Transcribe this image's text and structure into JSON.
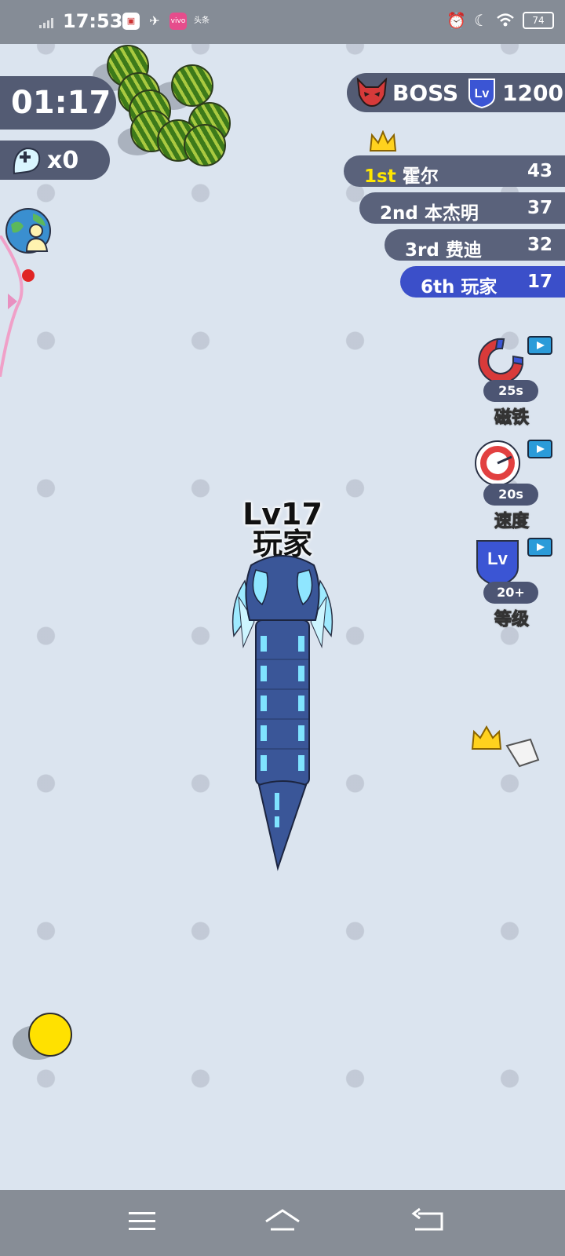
{
  "status_bar": {
    "time": "17:53",
    "battery": "74",
    "app_icons": [
      "notification-app-icon",
      "bird-icon",
      "vivo-icon",
      "toutiao-icon"
    ],
    "toutiao_label": "头条",
    "vivo_label": "vivo"
  },
  "hud": {
    "timer": "01:17",
    "revive_count": "x0",
    "boss": {
      "label": "BOSS",
      "level_badge": "Lv",
      "value": "1200"
    }
  },
  "leaderboard": [
    {
      "rank": "1st",
      "name": "霍尔",
      "score": "43",
      "highlight_color": "#ffe600"
    },
    {
      "rank": "2nd",
      "name": "本杰明",
      "score": "37"
    },
    {
      "rank": "3rd",
      "name": "费迪",
      "score": "32"
    },
    {
      "rank": "6th",
      "name": "玩家",
      "score": "17",
      "is_player": true
    }
  ],
  "powerups": [
    {
      "name": "磁铁",
      "timer": "25s",
      "icon": "magnet-icon"
    },
    {
      "name": "速度",
      "timer": "20s",
      "icon": "speedometer-icon"
    },
    {
      "name": "等级",
      "timer": "20+",
      "icon": "level-up-icon",
      "badge": "Lv"
    }
  ],
  "player": {
    "level": "Lv17",
    "name": "玩家"
  },
  "colors": {
    "background": "#dbe4ef",
    "panel": "#535b73",
    "player_row": "#3b4fc9",
    "first_place": "#ffe600",
    "snake_body": "#3a5698",
    "snake_glow": "#7fe3ff"
  }
}
